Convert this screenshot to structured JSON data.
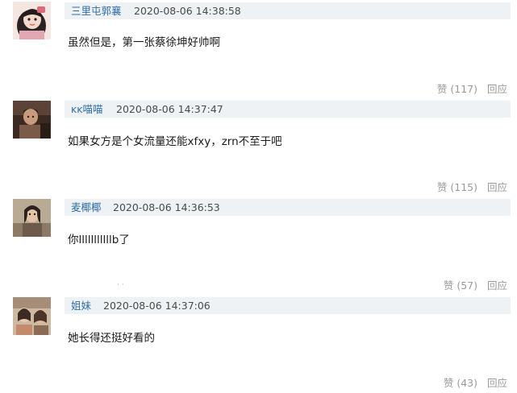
{
  "comments": [
    {
      "username": "三里屯郭襄",
      "time": "2020-08-06 14:38:58",
      "text": "虽然但是，第一张蔡徐坤好帅啊",
      "likes": "赞 (117)",
      "reply": "回应"
    },
    {
      "username": "ᴋᴋ喵喵",
      "time": "2020-08-06 14:37:47",
      "text": "如果女方是个女流量还能xfxy，zrn不至于吧",
      "likes": "赞 (115)",
      "reply": "回应"
    },
    {
      "username": "麦椰椰",
      "time": "2020-08-06 14:36:53",
      "text": "你lllllllllllb了",
      "likes": "赞 (57)",
      "reply": "回应"
    },
    {
      "username": "姐妹",
      "time": "2020-08-06 14:37:06",
      "text": "她长得还挺好看的",
      "likes": "赞 (43)",
      "reply": "回应"
    }
  ],
  "stray_mark": "· ·"
}
